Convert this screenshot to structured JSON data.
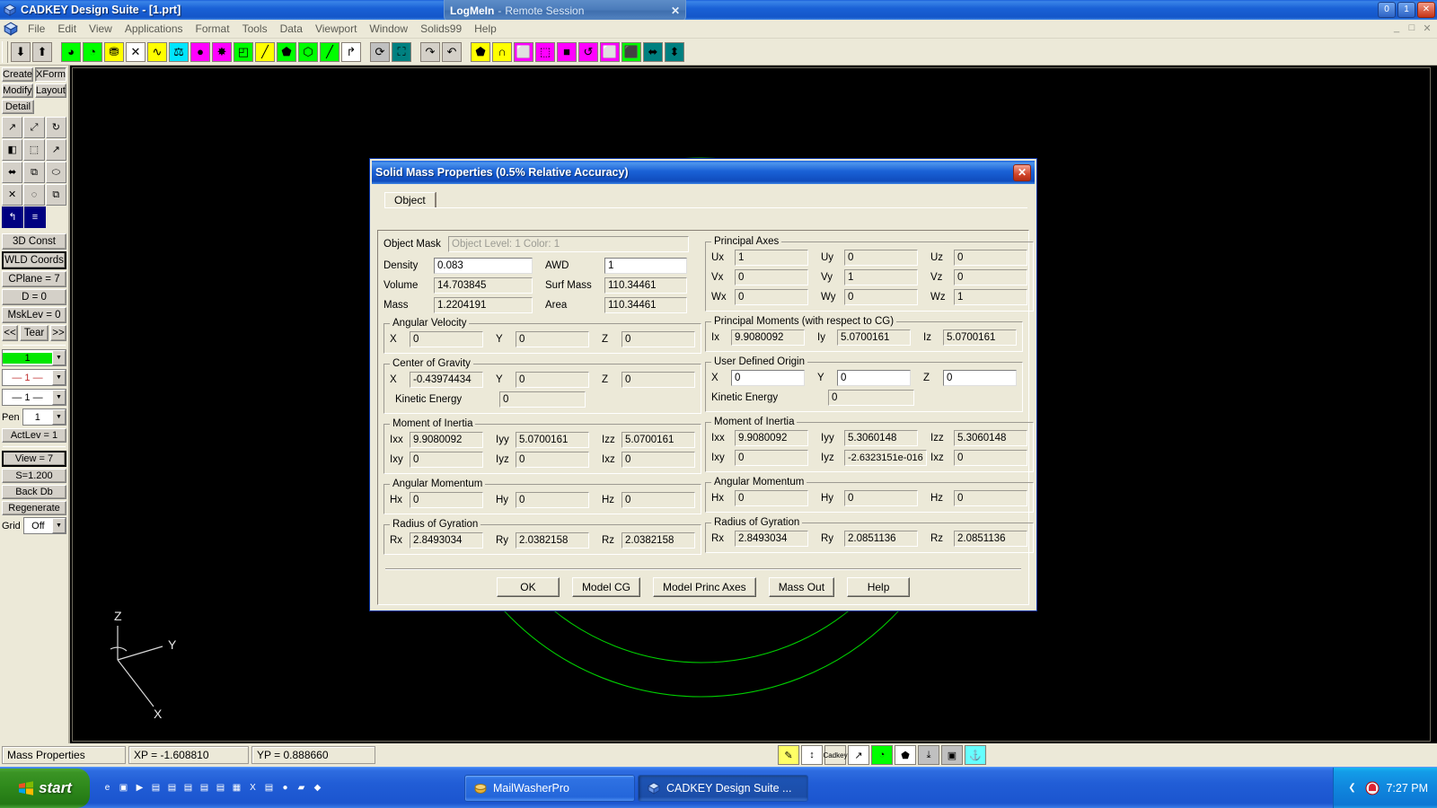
{
  "window": {
    "title": "CADKEY Design Suite - [1.prt]",
    "app_icon": "cadkey-icon",
    "minimize": "0",
    "maximize": "1",
    "close": "✕",
    "inner_minimize": "_",
    "inner_maximize": "□",
    "inner_close": "✕"
  },
  "logmein": {
    "name": "LogMeIn",
    "separator": "-",
    "subtitle": "Remote Session",
    "close": "✕"
  },
  "menu": {
    "items": [
      "File",
      "Edit",
      "View",
      "Applications",
      "Format",
      "Tools",
      "Data",
      "Viewport",
      "Window",
      "Solids99",
      "Help"
    ]
  },
  "toolbar": {
    "buttons": [
      {
        "name": "down-arrow-icon",
        "glyph": "⬇",
        "bg": "#d4d0c8"
      },
      {
        "name": "up-arrow-icon",
        "glyph": "⬆",
        "bg": "#d4d0c8"
      },
      {
        "name": "solid-sphere-icon",
        "glyph": "◕",
        "bg": "#00ff00"
      },
      {
        "name": "solid-ball-icon",
        "glyph": "◔",
        "bg": "#00ff00"
      },
      {
        "name": "cylinder-icon",
        "glyph": "⛃",
        "bg": "#ffff00"
      },
      {
        "name": "section-cut-icon",
        "glyph": "✕",
        "bg": "#ffffff"
      },
      {
        "name": "spline-icon",
        "glyph": "∿",
        "bg": "#ffff00"
      },
      {
        "name": "mass-properties-icon",
        "glyph": "⚖",
        "bg": "#00e5ff"
      },
      {
        "name": "shading-icon",
        "glyph": "●",
        "bg": "#ff00ff"
      },
      {
        "name": "explode-icon",
        "glyph": "✸",
        "bg": "#ff00ff"
      },
      {
        "name": "extrude-icon",
        "glyph": "◰",
        "bg": "#00ff00"
      },
      {
        "name": "sweep-icon",
        "glyph": "╱",
        "bg": "#ffff00"
      },
      {
        "name": "boolean-union-icon",
        "glyph": "⬟",
        "bg": "#00ff00"
      },
      {
        "name": "boolean-cut-icon",
        "glyph": "⬡",
        "bg": "#00ff00"
      },
      {
        "name": "blend-icon",
        "glyph": "╱",
        "bg": "#00ff00"
      },
      {
        "name": "transform-icon",
        "glyph": "↱",
        "bg": "#ffffff"
      },
      {
        "name": "rotate-solid-icon",
        "glyph": "⟳",
        "bg": "#c0c0c0"
      },
      {
        "name": "fit-window-icon",
        "glyph": "⛶",
        "bg": "#008080"
      },
      {
        "name": "redo-icon",
        "glyph": "↷",
        "bg": "#d4d0c8"
      },
      {
        "name": "undo-icon",
        "glyph": "↶",
        "bg": "#d4d0c8"
      },
      {
        "name": "isometric-view-icon",
        "glyph": "⬟",
        "bg": "#ffff00"
      },
      {
        "name": "arch-view-icon",
        "glyph": "∩",
        "bg": "#ffff00"
      },
      {
        "name": "cube-view-icon",
        "glyph": "⬜",
        "bg": "#ff00ff"
      },
      {
        "name": "wireframe-icon",
        "glyph": "⬚",
        "bg": "#ff00ff"
      },
      {
        "name": "color-cube-icon",
        "glyph": "■",
        "bg": "#ff00ff"
      },
      {
        "name": "rotate-view-icon",
        "glyph": "↺",
        "bg": "#ff00ff"
      },
      {
        "name": "box-icon",
        "glyph": "⬜",
        "bg": "#ff00ff"
      },
      {
        "name": "solid-box-icon",
        "glyph": "⬛",
        "bg": "#00ff00"
      },
      {
        "name": "dynamic-rotate-icon",
        "glyph": "⬌",
        "bg": "#008080"
      },
      {
        "name": "dynamic-pan-icon",
        "glyph": "⬍",
        "bg": "#008080"
      }
    ]
  },
  "sidebar": {
    "mode_buttons": [
      {
        "label": "Create",
        "pressed": false
      },
      {
        "label": "XForm",
        "pressed": true
      },
      {
        "label": "Modify",
        "pressed": false
      },
      {
        "label": "Layout",
        "pressed": false
      },
      {
        "label": "Detail",
        "pressed": false
      }
    ],
    "tool_icons": [
      [
        {
          "name": "translate-icon",
          "glyph": "↗"
        },
        {
          "name": "scale-icon",
          "glyph": "⤢"
        },
        {
          "name": "rotate-icon",
          "glyph": "↻"
        }
      ],
      [
        {
          "name": "mirror-icon",
          "glyph": "◧"
        },
        {
          "name": "project-icon",
          "glyph": "⬚"
        },
        {
          "name": "offset-icon",
          "glyph": "↗"
        }
      ],
      [
        {
          "name": "stretch-icon",
          "glyph": "⬌"
        },
        {
          "name": "array-icon",
          "glyph": "⧉"
        },
        {
          "name": "revolve-icon",
          "glyph": "⬭"
        }
      ],
      [
        {
          "name": "explode-xform-icon",
          "glyph": "✕"
        },
        {
          "name": "circular-array-icon",
          "glyph": "◌"
        },
        {
          "name": "copy-icon",
          "glyph": "⧉"
        }
      ],
      [
        {
          "name": "dynamic-xform-icon",
          "glyph": "↰",
          "selected": true
        },
        {
          "name": "properties-icon",
          "glyph": "≡",
          "selected": true
        }
      ]
    ],
    "status_buttons": [
      {
        "label": "3D Const",
        "bold": false
      },
      {
        "label": "WLD Coords",
        "bold": true
      },
      {
        "label": "CPlane = 7",
        "bold": false
      },
      {
        "label": "D = 0",
        "bold": false
      },
      {
        "label": "MskLev = 0",
        "bold": false
      }
    ],
    "tear_row": {
      "prev": "<<",
      "tear": "Tear",
      "next": ">>"
    },
    "color_combo": {
      "value": "1",
      "color": "#00e800"
    },
    "linetype_combo": {
      "value": "— 1 —"
    },
    "linewidth_combo": {
      "value": "— 1 —"
    },
    "pen": {
      "label": "Pen",
      "value": "1"
    },
    "actlev": {
      "label": "ActLev =  1"
    },
    "view_buttons": [
      {
        "label": "View = 7",
        "bold": true
      },
      {
        "label": "S=1.200",
        "bold": false
      },
      {
        "label": "Back Db",
        "bold": false
      },
      {
        "label": "Regenerate",
        "bold": false
      }
    ],
    "grid": {
      "label": "Grid",
      "value": "Off"
    }
  },
  "axis_indicator": {
    "z": "Z",
    "y": "Y",
    "x": "X"
  },
  "dialog": {
    "title": "Solid Mass Properties (0.5% Relative Accuracy)",
    "close": "✕",
    "tab": "Object",
    "object_mask": {
      "label": "Object Mask",
      "value": "Object Level: 1   Color: 1"
    },
    "basic": {
      "density": {
        "label": "Density",
        "value": "0.083"
      },
      "volume": {
        "label": "Volume",
        "value": "14.703845"
      },
      "mass": {
        "label": "Mass",
        "value": "1.2204191"
      },
      "awd": {
        "label": "AWD",
        "value": "1"
      },
      "surf_mass": {
        "label": "Surf Mass",
        "value": "110.34461"
      },
      "area": {
        "label": "Area",
        "value": "110.34461"
      }
    },
    "angular_velocity": {
      "legend": "Angular Velocity",
      "x": {
        "label": "X",
        "value": "0"
      },
      "y": {
        "label": "Y",
        "value": "0"
      },
      "z": {
        "label": "Z",
        "value": "0"
      }
    },
    "center_of_gravity": {
      "legend": "Center of Gravity",
      "x": {
        "label": "X",
        "value": "-0.43974434"
      },
      "y": {
        "label": "Y",
        "value": "0"
      },
      "z": {
        "label": "Z",
        "value": "0"
      },
      "kinetic_energy": {
        "label": "Kinetic Energy",
        "value": "0"
      }
    },
    "moment_of_inertia_left": {
      "legend": "Moment of Inertia",
      "ixx": {
        "label": "Ixx",
        "value": "9.9080092"
      },
      "iyy": {
        "label": "Iyy",
        "value": "5.0700161"
      },
      "izz": {
        "label": "Izz",
        "value": "5.0700161"
      },
      "ixy": {
        "label": "Ixy",
        "value": "0"
      },
      "iyz": {
        "label": "Iyz",
        "value": "0"
      },
      "ixz": {
        "label": "Ixz",
        "value": "0"
      }
    },
    "angular_momentum_left": {
      "legend": "Angular Momentum",
      "hx": {
        "label": "Hx",
        "value": "0"
      },
      "hy": {
        "label": "Hy",
        "value": "0"
      },
      "hz": {
        "label": "Hz",
        "value": "0"
      }
    },
    "radius_of_gyration_left": {
      "legend": "Radius of Gyration",
      "rx": {
        "label": "Rx",
        "value": "2.8493034"
      },
      "ry": {
        "label": "Ry",
        "value": "2.0382158"
      },
      "rz": {
        "label": "Rz",
        "value": "2.0382158"
      }
    },
    "principal_axes": {
      "legend": "Principal Axes",
      "ux": {
        "label": "Ux",
        "value": "1"
      },
      "uy": {
        "label": "Uy",
        "value": "0"
      },
      "uz": {
        "label": "Uz",
        "value": "0"
      },
      "vx": {
        "label": "Vx",
        "value": "0"
      },
      "vy": {
        "label": "Vy",
        "value": "1"
      },
      "vz": {
        "label": "Vz",
        "value": "0"
      },
      "wx": {
        "label": "Wx",
        "value": "0"
      },
      "wy": {
        "label": "Wy",
        "value": "0"
      },
      "wz": {
        "label": "Wz",
        "value": "1"
      }
    },
    "principal_moments": {
      "legend": "Principal Moments (with respect to CG)",
      "ix": {
        "label": "Ix",
        "value": "9.9080092"
      },
      "iy": {
        "label": "Iy",
        "value": "5.0700161"
      },
      "iz": {
        "label": "Iz",
        "value": "5.0700161"
      }
    },
    "user_defined_origin": {
      "legend": "User Defined Origin",
      "x": {
        "label": "X",
        "value": "0"
      },
      "y": {
        "label": "Y",
        "value": "0"
      },
      "z": {
        "label": "Z",
        "value": "0"
      },
      "kinetic_energy": {
        "label": "Kinetic Energy",
        "value": "0"
      }
    },
    "moment_of_inertia_right": {
      "legend": "Moment of Inertia",
      "ixx": {
        "label": "Ixx",
        "value": "9.9080092"
      },
      "iyy": {
        "label": "Iyy",
        "value": "5.3060148"
      },
      "izz": {
        "label": "Izz",
        "value": "5.3060148"
      },
      "ixy": {
        "label": "Ixy",
        "value": "0"
      },
      "iyz": {
        "label": "Iyz",
        "value": "-2.6323151e-016"
      },
      "ixz": {
        "label": "Ixz",
        "value": "0"
      }
    },
    "angular_momentum_right": {
      "legend": "Angular Momentum",
      "hx": {
        "label": "Hx",
        "value": "0"
      },
      "hy": {
        "label": "Hy",
        "value": "0"
      },
      "hz": {
        "label": "Hz",
        "value": "0"
      }
    },
    "radius_of_gyration_right": {
      "legend": "Radius of Gyration",
      "rx": {
        "label": "Rx",
        "value": "2.8493034"
      },
      "ry": {
        "label": "Ry",
        "value": "2.0851136"
      },
      "rz": {
        "label": "Rz",
        "value": "2.0851136"
      }
    },
    "buttons": [
      {
        "label": "OK",
        "name": "ok-button"
      },
      {
        "label": "Model CG",
        "name": "model-cg-button"
      },
      {
        "label": "Model Princ Axes",
        "name": "model-princ-axes-button"
      },
      {
        "label": "Mass Out",
        "name": "mass-out-button"
      },
      {
        "label": "Help",
        "name": "help-button"
      }
    ]
  },
  "statusbar": {
    "prompt": "Mass Properties",
    "xp": "XP = -1.608810",
    "yp": "YP = 0.888660",
    "tools": [
      {
        "name": "note-tool-icon",
        "glyph": "✎",
        "bg": "#ffff66"
      },
      {
        "name": "dimension-tool-icon",
        "glyph": "↕",
        "bg": "#ffffff"
      },
      {
        "name": "cadkey-tool-icon",
        "glyph": "Cadkey",
        "bg": "#ece9d8"
      },
      {
        "name": "arrow-tool-icon",
        "glyph": "↗",
        "bg": "#ffffff"
      },
      {
        "name": "clock-tool-icon",
        "glyph": "◔",
        "bg": "#00ff00"
      },
      {
        "name": "shield-tool-icon",
        "glyph": "⬟",
        "bg": "#ffffff"
      },
      {
        "name": "export-tool-icon",
        "glyph": "⤓",
        "bg": "#c0c0c0"
      },
      {
        "name": "save-tool-icon",
        "glyph": "▣",
        "bg": "#c0c0c0"
      },
      {
        "name": "text-tool-icon",
        "glyph": "⚓",
        "bg": "#66ffff"
      }
    ]
  },
  "taskbar": {
    "start": "start",
    "quick_launch": [
      {
        "name": "ie-quicklaunch-icon",
        "glyph": "e"
      },
      {
        "name": "desktop-quicklaunch-icon",
        "glyph": "▣"
      },
      {
        "name": "media-quicklaunch-icon",
        "glyph": "▶"
      },
      {
        "name": "doc1-quicklaunch-icon",
        "glyph": "▤"
      },
      {
        "name": "doc2-quicklaunch-icon",
        "glyph": "▤"
      },
      {
        "name": "doc3-quicklaunch-icon",
        "glyph": "▤"
      },
      {
        "name": "doc4-quicklaunch-icon",
        "glyph": "▤"
      },
      {
        "name": "doc5-quicklaunch-icon",
        "glyph": "▤"
      },
      {
        "name": "calendar-quicklaunch-icon",
        "glyph": "▦"
      },
      {
        "name": "excel-quicklaunch-icon",
        "glyph": "X"
      },
      {
        "name": "doc6-quicklaunch-icon",
        "glyph": "▤"
      },
      {
        "name": "web-quicklaunch-icon",
        "glyph": "●"
      },
      {
        "name": "folder-quicklaunch-icon",
        "glyph": "▰"
      },
      {
        "name": "app-quicklaunch-icon",
        "glyph": "◆"
      }
    ],
    "items": [
      {
        "label": "MailWasherPro",
        "icon": "mailwasher-icon",
        "active": false
      },
      {
        "label": "CADKEY Design Suite ...",
        "icon": "cadkey-icon",
        "active": true
      }
    ],
    "tray": {
      "show_hidden": "❮",
      "icons": [
        {
          "name": "security-tray-icon",
          "glyph": "⛉"
        }
      ],
      "clock": "7:27 PM"
    }
  }
}
